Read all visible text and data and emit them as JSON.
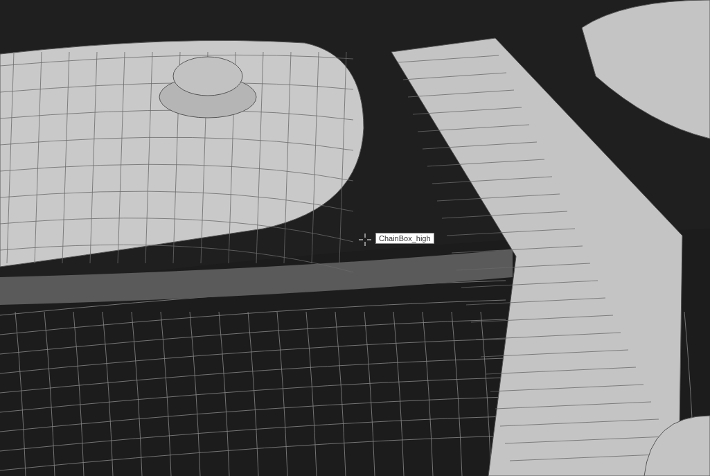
{
  "viewport": {
    "tooltip": "ChainBox_high"
  }
}
